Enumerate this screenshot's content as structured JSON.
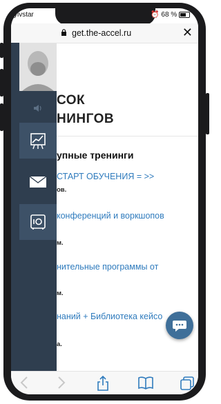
{
  "status": {
    "carrier": "yivstar",
    "battery": "68 %"
  },
  "browser": {
    "url": "get.the-accel.ru",
    "close_label": "✕"
  },
  "page": {
    "title_line1": "СОК",
    "title_line2": "НИНГОВ",
    "section": "упные тренинги",
    "links": [
      "СТАРТ ОБУЧЕНИЯ = >>",
      "конференций и воркшопов",
      "нительные программы от",
      "наний + Библиотека кейсо"
    ],
    "small_texts": [
      "ов.",
      "м.",
      "м.",
      "а."
    ]
  },
  "sidebar": {
    "items": [
      "sound-icon",
      "chart-icon",
      "mail-icon",
      "safe-icon"
    ]
  },
  "colors": {
    "sidebar": "#2f3e4f",
    "link": "#2f7bbd",
    "chat": "#3f6f99"
  }
}
